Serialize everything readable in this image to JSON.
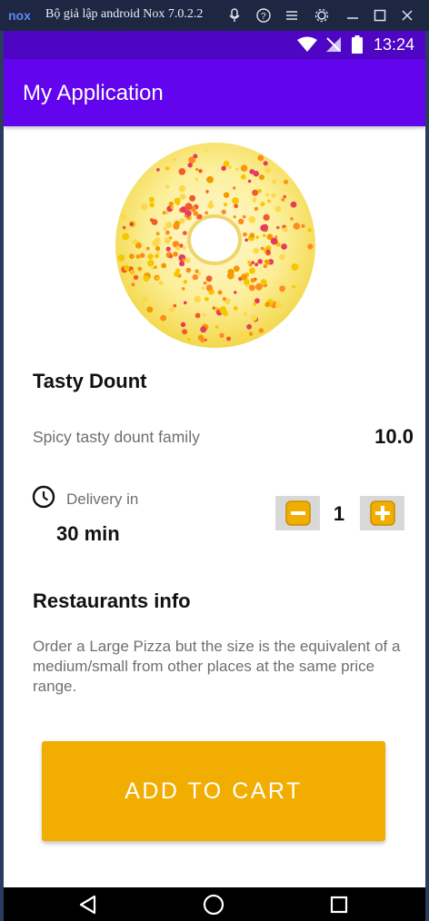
{
  "emulator": {
    "title": "Bộ giả lập android Nox 7.0.2.2",
    "logo_text": "nox",
    "controls": [
      "mic-icon",
      "help-icon",
      "menu-icon",
      "settings-icon",
      "minimize-icon",
      "maximize-icon",
      "close-icon"
    ]
  },
  "status_bar": {
    "time": "13:24",
    "icons": [
      "wifi-icon",
      "no-signal-icon",
      "battery-icon"
    ]
  },
  "app_bar": {
    "title": "My Application"
  },
  "product": {
    "name": "Tasty Dount",
    "description": "Spicy tasty dount family",
    "price": "10.0",
    "image": "donut-image"
  },
  "delivery": {
    "label": "Delivery in",
    "value": "30 min"
  },
  "quantity": {
    "value": "1"
  },
  "restaurant_info": {
    "title": "Restaurants info",
    "text": "Order a Large Pizza but the size is the equivalent of a medium/small from other places at the same price range."
  },
  "cart": {
    "button_label": "ADD TO CART"
  },
  "colors": {
    "status_bar": "#4f05c4",
    "app_bar": "#6204ee",
    "accent": "#f2ae00",
    "qty_button_bg": "#d8d8d8"
  },
  "nav_bar": {
    "icons": [
      "back-icon",
      "home-icon",
      "recents-icon"
    ]
  }
}
